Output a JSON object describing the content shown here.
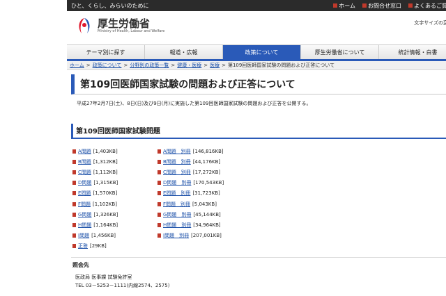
{
  "topbar": {
    "tagline": "ひと、くらし、みらいのために",
    "links": [
      "ホーム",
      "お問合せ窓口",
      "よくあるご質問"
    ]
  },
  "header": {
    "logo_title": "厚生労働省",
    "logo_sub": "Ministry of Health, Labour and Welfare",
    "font_size_label": "文字サイズの変更"
  },
  "nav": {
    "tabs": [
      "テーマ別に探す",
      "報道・広報",
      "政策について",
      "厚生労働省について",
      "統計情報・白書"
    ],
    "active": 2
  },
  "breadcrumb": {
    "items": [
      "ホーム",
      "政策について",
      "分野別の政策一覧",
      "健康・医療",
      "医療"
    ],
    "current": "第109回医師国家試験の問題および正答について"
  },
  "page": {
    "title": "第109回医師国家試験の問題および正答について",
    "intro": "平成27年2月7日(土)、8日(日)及び9日(月)に実施した第109回医師国家試験の問題および正答を公開する。",
    "section_title": "第109回医師国家試験問題"
  },
  "files_left": [
    {
      "label": "A問題",
      "size": "[1,403KB]"
    },
    {
      "label": "B問題",
      "size": "[1,312KB]"
    },
    {
      "label": "C問題",
      "size": "[1,112KB]"
    },
    {
      "label": "D問題",
      "size": "[1,315KB]"
    },
    {
      "label": "E問題",
      "size": "[1,570KB]"
    },
    {
      "label": "F問題",
      "size": "[1,102KB]"
    },
    {
      "label": "G問題",
      "size": "[1,326KB]"
    },
    {
      "label": "H問題",
      "size": "[1,164KB]"
    },
    {
      "label": "I問題",
      "size": "[1,456KB]"
    },
    {
      "label": "正答",
      "size": "[29KB]"
    }
  ],
  "files_right": [
    {
      "label": "A問題　別冊",
      "size": "[146,816KB]"
    },
    {
      "label": "B問題　別冊",
      "size": "[44,176KB]"
    },
    {
      "label": "C問題　別冊",
      "size": "[17,272KB]"
    },
    {
      "label": "D問題　別冊",
      "size": "[170,543KB]"
    },
    {
      "label": "E問題　別冊",
      "size": "[31,723KB]"
    },
    {
      "label": "F問題　別冊",
      "size": "[5,043KB]"
    },
    {
      "label": "G問題　別冊",
      "size": "[45,144KB]"
    },
    {
      "label": "H問題　別冊",
      "size": "[34,964KB]"
    },
    {
      "label": "I問題　別冊",
      "size": "[207,001KB]"
    }
  ],
  "contact": {
    "heading": "照会先",
    "dept": "医政局 医事課 試験免許室",
    "tel": "TEL  03－5253－1111(内線2574、2575)"
  },
  "colors": {
    "accent": "#2a5ab8",
    "pdf": "#c0392b",
    "link": "#1a4fa8"
  }
}
